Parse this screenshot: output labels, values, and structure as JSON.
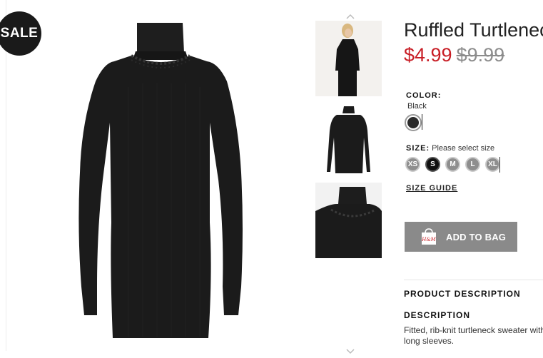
{
  "badge": {
    "sale": "SALE"
  },
  "product": {
    "title": "Ruffled Turtleneck Sweater",
    "price_sale": "$4.99",
    "price_original": "$9.99"
  },
  "color": {
    "label": "COLOR:",
    "value": "Black",
    "swatches": [
      {
        "name": "Black",
        "hex": "#2b2b2b",
        "selected": true
      }
    ]
  },
  "size": {
    "label": "SIZE:",
    "hint": "Please select size",
    "options": [
      {
        "label": "XS",
        "selected": false
      },
      {
        "label": "S",
        "selected": true
      },
      {
        "label": "M",
        "selected": false
      },
      {
        "label": "L",
        "selected": false
      },
      {
        "label": "XL",
        "selected": false
      }
    ]
  },
  "size_guide": "SIZE GUIDE",
  "add_to_bag": {
    "label": "ADD TO BAG",
    "icon": "shopping-bag-icon",
    "icon_text": "H&M"
  },
  "product_description": {
    "heading": "PRODUCT DESCRIPTION"
  },
  "description": {
    "heading": "DESCRIPTION",
    "text": "Fitted, rib-knit turtleneck sweater with long sleeves."
  },
  "colors": {
    "sale_red": "#c81d25",
    "button_gray": "#8a8a8a",
    "garment": "#1b1b1b"
  }
}
